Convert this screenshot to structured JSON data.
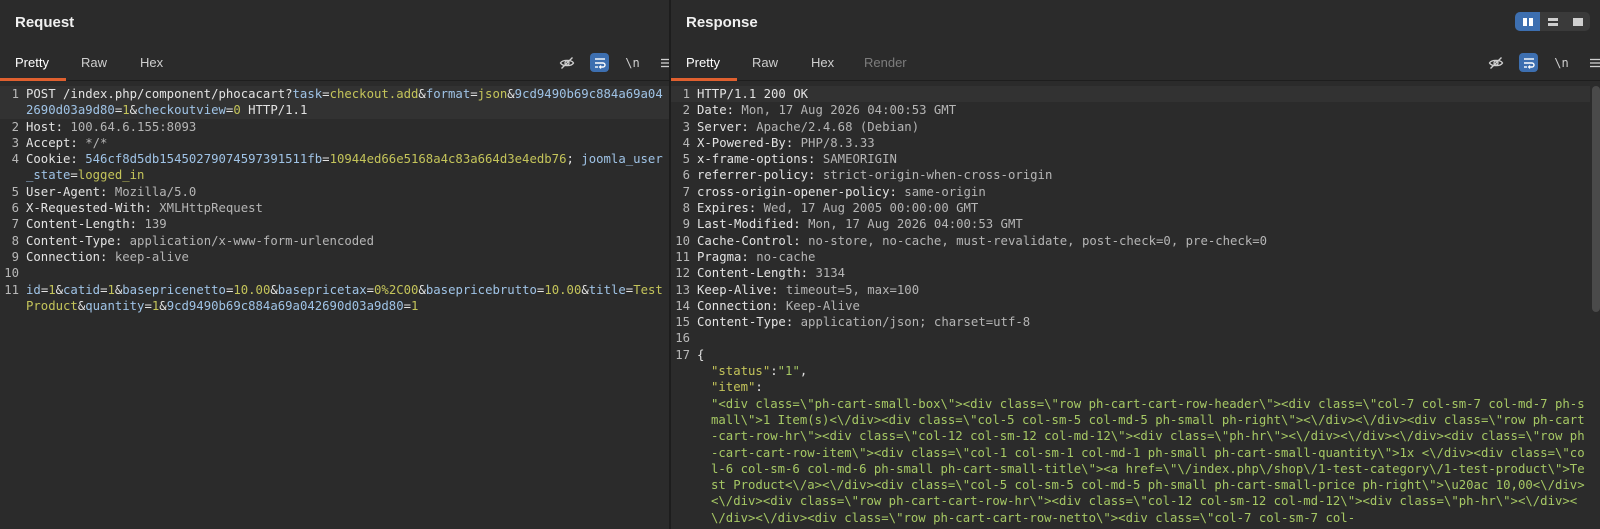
{
  "request": {
    "title": "Request",
    "tabs": [
      "Pretty",
      "Raw",
      "Hex"
    ],
    "active_tab": "Pretty",
    "newline_label": "\\n",
    "lines": [
      {
        "n": "1",
        "parts": [
          {
            "t": "POST /index.php/component/phocacart?",
            "c": "k"
          },
          {
            "t": "task",
            "c": "blue"
          },
          {
            "t": "=",
            "c": "k"
          },
          {
            "t": "checkout.add",
            "c": "pv"
          },
          {
            "t": "&",
            "c": "k"
          },
          {
            "t": "format",
            "c": "blue"
          },
          {
            "t": "=",
            "c": "k"
          },
          {
            "t": "json",
            "c": "pv"
          },
          {
            "t": "&",
            "c": "k"
          },
          {
            "t": "9cd9490b69c884a69a042690d03a9d80",
            "c": "blue"
          },
          {
            "t": "=",
            "c": "k"
          },
          {
            "t": "1",
            "c": "pv"
          },
          {
            "t": "&",
            "c": "k"
          },
          {
            "t": "checkoutview",
            "c": "blue"
          },
          {
            "t": "=",
            "c": "k"
          },
          {
            "t": "0",
            "c": "pv"
          },
          {
            "t": " HTTP/1.1",
            "c": "k"
          }
        ]
      },
      {
        "n": "2",
        "parts": [
          {
            "t": "Host: ",
            "c": "k"
          },
          {
            "t": "100.64.6.155:8093",
            "c": "hval"
          }
        ]
      },
      {
        "n": "3",
        "parts": [
          {
            "t": "Accept: ",
            "c": "k"
          },
          {
            "t": "*/*",
            "c": "hval"
          }
        ]
      },
      {
        "n": "4",
        "parts": [
          {
            "t": "Cookie: ",
            "c": "k"
          },
          {
            "t": "546cf8d5db15450279074597391511fb",
            "c": "blue"
          },
          {
            "t": "=",
            "c": "k"
          },
          {
            "t": "10944ed66e5168a4c83a664d3e4edb76",
            "c": "pv"
          },
          {
            "t": "; ",
            "c": "k"
          },
          {
            "t": "joomla_user_state",
            "c": "blue"
          },
          {
            "t": "=",
            "c": "k"
          },
          {
            "t": "logged_in",
            "c": "pv"
          }
        ]
      },
      {
        "n": "5",
        "parts": [
          {
            "t": "User-Agent: ",
            "c": "k"
          },
          {
            "t": "Mozilla/5.0",
            "c": "hval"
          }
        ]
      },
      {
        "n": "6",
        "parts": [
          {
            "t": "X-Requested-With: ",
            "c": "k"
          },
          {
            "t": "XMLHttpRequest",
            "c": "hval"
          }
        ]
      },
      {
        "n": "7",
        "parts": [
          {
            "t": "Content-Length: ",
            "c": "k"
          },
          {
            "t": "139",
            "c": "hval"
          }
        ]
      },
      {
        "n": "8",
        "parts": [
          {
            "t": "Content-Type: ",
            "c": "k"
          },
          {
            "t": "application/x-www-form-urlencoded",
            "c": "hval"
          }
        ]
      },
      {
        "n": "9",
        "parts": [
          {
            "t": "Connection: ",
            "c": "k"
          },
          {
            "t": "keep-alive",
            "c": "hval"
          }
        ]
      },
      {
        "n": "10",
        "parts": []
      },
      {
        "n": "11",
        "parts": [
          {
            "t": "id",
            "c": "blue"
          },
          {
            "t": "=",
            "c": "k"
          },
          {
            "t": "1",
            "c": "pv"
          },
          {
            "t": "&",
            "c": "k"
          },
          {
            "t": "catid",
            "c": "blue"
          },
          {
            "t": "=",
            "c": "k"
          },
          {
            "t": "1",
            "c": "pv"
          },
          {
            "t": "&",
            "c": "k"
          },
          {
            "t": "basepricenetto",
            "c": "blue"
          },
          {
            "t": "=",
            "c": "k"
          },
          {
            "t": "10.00",
            "c": "pv"
          },
          {
            "t": "&",
            "c": "k"
          },
          {
            "t": "basepricetax",
            "c": "blue"
          },
          {
            "t": "=",
            "c": "k"
          },
          {
            "t": "0%2C00",
            "c": "pv"
          },
          {
            "t": "&",
            "c": "k"
          },
          {
            "t": "basepricebrutto",
            "c": "blue"
          },
          {
            "t": "=",
            "c": "k"
          },
          {
            "t": "10.00",
            "c": "pv"
          },
          {
            "t": "&",
            "c": "k"
          },
          {
            "t": "title",
            "c": "blue"
          },
          {
            "t": "=",
            "c": "k"
          },
          {
            "t": "TestProduct",
            "c": "pv"
          },
          {
            "t": "&",
            "c": "k"
          },
          {
            "t": "quantity",
            "c": "blue"
          },
          {
            "t": "=",
            "c": "k"
          },
          {
            "t": "1",
            "c": "pv"
          },
          {
            "t": "&",
            "c": "k"
          },
          {
            "t": "9cd9490b69c884a69a042690d03a9d80",
            "c": "blue"
          },
          {
            "t": "=",
            "c": "k"
          },
          {
            "t": "1",
            "c": "pv"
          }
        ]
      }
    ]
  },
  "response": {
    "title": "Response",
    "tabs": [
      "Pretty",
      "Raw",
      "Hex",
      "Render"
    ],
    "active_tab": "Pretty",
    "disabled_tab": "Render",
    "newline_label": "\\n",
    "lines": [
      {
        "n": "1",
        "parts": [
          {
            "t": "HTTP/1.1 200 OK",
            "c": "k"
          }
        ]
      },
      {
        "n": "2",
        "parts": [
          {
            "t": "Date: ",
            "c": "k"
          },
          {
            "t": "Mon, 17 Aug 2026 04:00:53 GMT",
            "c": "hval"
          }
        ]
      },
      {
        "n": "3",
        "parts": [
          {
            "t": "Server: ",
            "c": "k"
          },
          {
            "t": "Apache/2.4.68 (Debian)",
            "c": "hval"
          }
        ]
      },
      {
        "n": "4",
        "parts": [
          {
            "t": "X-Powered-By: ",
            "c": "k"
          },
          {
            "t": "PHP/8.3.33",
            "c": "hval"
          }
        ]
      },
      {
        "n": "5",
        "parts": [
          {
            "t": "x-frame-options: ",
            "c": "k"
          },
          {
            "t": "SAMEORIGIN",
            "c": "hval"
          }
        ]
      },
      {
        "n": "6",
        "parts": [
          {
            "t": "referrer-policy: ",
            "c": "k"
          },
          {
            "t": "strict-origin-when-cross-origin",
            "c": "hval"
          }
        ]
      },
      {
        "n": "7",
        "parts": [
          {
            "t": "cross-origin-opener-policy: ",
            "c": "k"
          },
          {
            "t": "same-origin",
            "c": "hval"
          }
        ]
      },
      {
        "n": "8",
        "parts": [
          {
            "t": "Expires: ",
            "c": "k"
          },
          {
            "t": "Wed, 17 Aug 2005 00:00:00 GMT",
            "c": "hval"
          }
        ]
      },
      {
        "n": "9",
        "parts": [
          {
            "t": "Last-Modified: ",
            "c": "k"
          },
          {
            "t": "Mon, 17 Aug 2026 04:00:53 GMT",
            "c": "hval"
          }
        ]
      },
      {
        "n": "10",
        "parts": [
          {
            "t": "Cache-Control: ",
            "c": "k"
          },
          {
            "t": "no-store, no-cache, must-revalidate, post-check=0, pre-check=0",
            "c": "hval"
          }
        ]
      },
      {
        "n": "11",
        "parts": [
          {
            "t": "Pragma: ",
            "c": "k"
          },
          {
            "t": "no-cache",
            "c": "hval"
          }
        ]
      },
      {
        "n": "12",
        "parts": [
          {
            "t": "Content-Length: ",
            "c": "k"
          },
          {
            "t": "3134",
            "c": "hval"
          }
        ]
      },
      {
        "n": "13",
        "parts": [
          {
            "t": "Keep-Alive: ",
            "c": "k"
          },
          {
            "t": "timeout=5, max=100",
            "c": "hval"
          }
        ]
      },
      {
        "n": "14",
        "parts": [
          {
            "t": "Connection: ",
            "c": "k"
          },
          {
            "t": "Keep-Alive",
            "c": "hval"
          }
        ]
      },
      {
        "n": "15",
        "parts": [
          {
            "t": "Content-Type: ",
            "c": "k"
          },
          {
            "t": "application/json; charset=utf-8",
            "c": "hval"
          }
        ]
      },
      {
        "n": "16",
        "parts": []
      },
      {
        "n": "17",
        "parts": [
          {
            "t": "{",
            "c": "k"
          }
        ]
      },
      {
        "n": "",
        "indent": true,
        "parts": [
          {
            "t": "\"status\"",
            "c": "pv"
          },
          {
            "t": ":",
            "c": "k"
          },
          {
            "t": "\"1\"",
            "c": "str"
          },
          {
            "t": ",",
            "c": "k"
          }
        ]
      },
      {
        "n": "",
        "indent": true,
        "parts": [
          {
            "t": "\"item\"",
            "c": "pv"
          },
          {
            "t": ":",
            "c": "k"
          }
        ]
      },
      {
        "n": "",
        "indent": true,
        "parts": [
          {
            "t": "\"<div class=\\\"ph-cart-small-box\\\"><div class=\\\"row ph-cart-cart-row-header\\\"><div class=\\\"col-7 col-sm-7 col-md-7 ph-small\\\">1 Item(s)<\\/div><div class=\\\"col-5 col-sm-5 col-md-5 ph-small ph-right\\\"><\\/div><\\/div><div class=\\\"row ph-cart-cart-row-hr\\\"><div class=\\\"col-12 col-sm-12 col-md-12\\\"><div class=\\\"ph-hr\\\"><\\/div><\\/div><\\/div><div class=\\\"row ph-cart-cart-row-item\\\"><div class=\\\"col-1 col-sm-1 col-md-1 ph-small ph-cart-small-quantity\\\">1x <\\/div><div class=\\\"col-6 col-sm-6 col-md-6 ph-small ph-cart-small-title\\\"><a href=\\\"\\/index.php\\/shop\\/1-test-category\\/1-test-product\\\">Test Product<\\/a><\\/div><div class=\\\"col-5 col-sm-5 col-md-5 ph-small ph-cart-small-price ph-right\\\">\\u20ac 10,00<\\/div><\\/div><div class=\\\"row ph-cart-cart-row-hr\\\"><div class=\\\"col-12 col-sm-12 col-md-12\\\"><div class=\\\"ph-hr\\\"><\\/div><\\/div><\\/div><div class=\\\"row ph-cart-cart-row-netto\\\"><div class=\\\"col-7 col-sm-7 col-",
            "c": "str"
          }
        ]
      }
    ]
  }
}
